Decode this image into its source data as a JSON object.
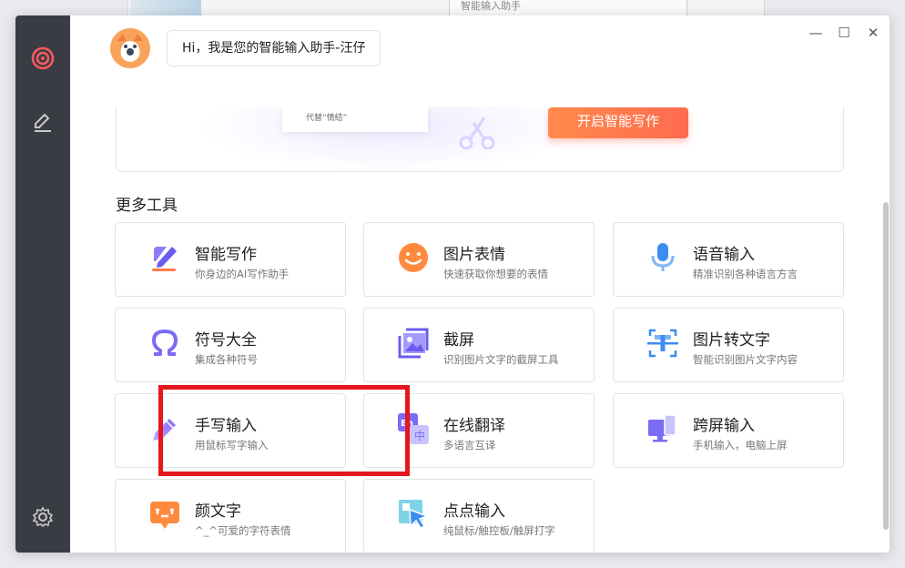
{
  "background": {
    "tab_text": "智能输入助手"
  },
  "window": {
    "controls": {
      "minimize": "—",
      "maximize": "☐",
      "close": "✕"
    }
  },
  "assistant": {
    "greeting": "Hi，我是您的智能输入助手-汪仔"
  },
  "banner": {
    "card_text": "代替“情结”",
    "button_label": "开启智能写作"
  },
  "more_tools": {
    "title": "更多工具",
    "items": [
      {
        "name": "智能写作",
        "desc": "你身边的AI写作助手",
        "icon": "pen-write-icon"
      },
      {
        "name": "图片表情",
        "desc": "快速获取你想要的表情",
        "icon": "smiley-icon"
      },
      {
        "name": "语音输入",
        "desc": "精准识别各种语言方言",
        "icon": "microphone-icon"
      },
      {
        "name": "符号大全",
        "desc": "集成各种符号",
        "icon": "omega-icon"
      },
      {
        "name": "截屏",
        "desc": "识别图片文字的截屏工具",
        "icon": "screenshot-icon"
      },
      {
        "name": "图片转文字",
        "desc": "智能识别图片文字内容",
        "icon": "ocr-icon"
      },
      {
        "name": "手写输入",
        "desc": "用鼠标写字输入",
        "icon": "handwriting-icon"
      },
      {
        "name": "在线翻译",
        "desc": "多语言互译",
        "icon": "translate-icon"
      },
      {
        "name": "跨屏输入",
        "desc": "手机输入，电脑上屏",
        "icon": "cross-screen-icon"
      },
      {
        "name": "颜文字",
        "desc": "^_^可爱的字符表情",
        "icon": "kaomoji-icon"
      },
      {
        "name": "点点输入",
        "desc": "纯鼠标/触控板/触屏打字",
        "icon": "click-input-icon"
      }
    ]
  },
  "colors": {
    "sidebar_bg": "#3a3c43",
    "accent_orange": "#ff7a4c",
    "highlight_red": "#e5161e",
    "icon_purple": "#7b6cf6"
  }
}
